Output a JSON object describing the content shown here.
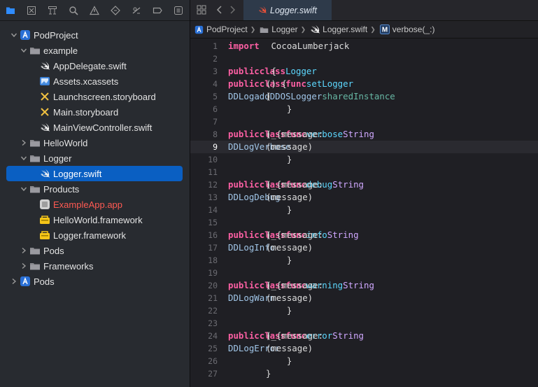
{
  "navigator": {
    "toolbar_icons": [
      "folder-icon",
      "source-control-icon",
      "symbol-icon",
      "search-icon",
      "issue-icon",
      "test-icon",
      "debug-icon",
      "breakpoint-icon",
      "report-icon"
    ],
    "tree": [
      {
        "label": "PodProject",
        "icon": "project-icon",
        "indent": 0,
        "disclosure": "open"
      },
      {
        "label": "example",
        "icon": "folder-icon",
        "indent": 1,
        "disclosure": "open"
      },
      {
        "label": "AppDelegate.swift",
        "icon": "swift-icon",
        "indent": 2,
        "disclosure": "none"
      },
      {
        "label": "Assets.xcassets",
        "icon": "assets-icon",
        "indent": 2,
        "disclosure": "none"
      },
      {
        "label": "Launchscreen.storyboard",
        "icon": "storyboard-icon",
        "indent": 2,
        "disclosure": "none"
      },
      {
        "label": "Main.storyboard",
        "icon": "storyboard-icon",
        "indent": 2,
        "disclosure": "none"
      },
      {
        "label": "MainViewController.swift",
        "icon": "swift-icon",
        "indent": 2,
        "disclosure": "none"
      },
      {
        "label": "HelloWorld",
        "icon": "folder-icon",
        "indent": 1,
        "disclosure": "closed"
      },
      {
        "label": "Logger",
        "icon": "folder-icon",
        "indent": 1,
        "disclosure": "open"
      },
      {
        "label": "Logger.swift",
        "icon": "swift-icon",
        "indent": 2,
        "disclosure": "none",
        "selected": true
      },
      {
        "label": "Products",
        "icon": "folder-icon",
        "indent": 1,
        "disclosure": "open"
      },
      {
        "label": "ExampleApp.app",
        "icon": "app-icon",
        "indent": 2,
        "disclosure": "none",
        "missing": true
      },
      {
        "label": "HelloWorld.framework",
        "icon": "framework-icon",
        "indent": 2,
        "disclosure": "none"
      },
      {
        "label": "Logger.framework",
        "icon": "framework-icon",
        "indent": 2,
        "disclosure": "none"
      },
      {
        "label": "Pods",
        "icon": "folder-icon",
        "indent": 1,
        "disclosure": "closed"
      },
      {
        "label": "Frameworks",
        "icon": "folder-icon",
        "indent": 1,
        "disclosure": "closed"
      },
      {
        "label": "Pods",
        "icon": "project-icon",
        "indent": 0,
        "disclosure": "closed"
      }
    ]
  },
  "editor": {
    "tab_label": "Logger.swift",
    "jump_bar": [
      {
        "label": "PodProject",
        "icon": "project-icon"
      },
      {
        "label": "Logger",
        "icon": "folder-icon"
      },
      {
        "label": "Logger.swift",
        "icon": "swift-icon"
      },
      {
        "label": "verbose(_:)",
        "icon": "method-icon"
      }
    ],
    "current_line": 9,
    "code": [
      [
        [
          "kw",
          "import"
        ],
        [
          "tx",
          " CocoaLumberjack"
        ]
      ],
      [],
      [
        [
          "kw",
          "public"
        ],
        [
          "tx",
          " "
        ],
        [
          "kw",
          "class"
        ],
        [
          "tx",
          " "
        ],
        [
          "fn",
          "Logger"
        ],
        [
          "tx",
          " {"
        ]
      ],
      [
        [
          "tx",
          "    "
        ],
        [
          "kw",
          "public"
        ],
        [
          "tx",
          " "
        ],
        [
          "kw",
          "class"
        ],
        [
          "tx",
          " "
        ],
        [
          "kw",
          "func"
        ],
        [
          "tx",
          " "
        ],
        [
          "fn",
          "setLogger"
        ],
        [
          "tx",
          "() {"
        ]
      ],
      [
        [
          "tx",
          "        "
        ],
        [
          "pj",
          "DDLog"
        ],
        [
          "tx",
          "."
        ],
        [
          "pj",
          "add"
        ],
        [
          "tx",
          "("
        ],
        [
          "pj",
          "DDOSLogger"
        ],
        [
          "tx",
          "."
        ],
        [
          "cx",
          "sharedInstance"
        ],
        [
          "tx",
          ")"
        ]
      ],
      [
        [
          "tx",
          "    }"
        ]
      ],
      [],
      [
        [
          "tx",
          "    "
        ],
        [
          "kw",
          "public"
        ],
        [
          "tx",
          " "
        ],
        [
          "kw",
          "class"
        ],
        [
          "tx",
          " "
        ],
        [
          "kw",
          "func"
        ],
        [
          "tx",
          " "
        ],
        [
          "fn",
          "verbose"
        ],
        [
          "tx",
          "(_ message: "
        ],
        [
          "ty",
          "String"
        ],
        [
          "tx",
          ") {"
        ]
      ],
      [
        [
          "tx",
          "        "
        ],
        [
          "pj",
          "DDLogVerbose"
        ],
        [
          "tx",
          "(message)"
        ]
      ],
      [
        [
          "tx",
          "    }"
        ]
      ],
      [],
      [
        [
          "tx",
          "    "
        ],
        [
          "kw",
          "public"
        ],
        [
          "tx",
          " "
        ],
        [
          "kw",
          "class"
        ],
        [
          "tx",
          " "
        ],
        [
          "kw",
          "func"
        ],
        [
          "tx",
          " "
        ],
        [
          "fn",
          "debug"
        ],
        [
          "tx",
          "(_ message: "
        ],
        [
          "ty",
          "String"
        ],
        [
          "tx",
          ") {"
        ]
      ],
      [
        [
          "tx",
          "        "
        ],
        [
          "pj",
          "DDLogDebug"
        ],
        [
          "tx",
          "(message)"
        ]
      ],
      [
        [
          "tx",
          "    }"
        ]
      ],
      [],
      [
        [
          "tx",
          "    "
        ],
        [
          "kw",
          "public"
        ],
        [
          "tx",
          " "
        ],
        [
          "kw",
          "class"
        ],
        [
          "tx",
          " "
        ],
        [
          "kw",
          "func"
        ],
        [
          "tx",
          " "
        ],
        [
          "fn",
          "info"
        ],
        [
          "tx",
          "(_ message: "
        ],
        [
          "ty",
          "String"
        ],
        [
          "tx",
          ") {"
        ]
      ],
      [
        [
          "tx",
          "        "
        ],
        [
          "pj",
          "DDLogInfo"
        ],
        [
          "tx",
          "(message)"
        ]
      ],
      [
        [
          "tx",
          "    }"
        ]
      ],
      [],
      [
        [
          "tx",
          "    "
        ],
        [
          "kw",
          "public"
        ],
        [
          "tx",
          " "
        ],
        [
          "kw",
          "class"
        ],
        [
          "tx",
          " "
        ],
        [
          "kw",
          "func"
        ],
        [
          "tx",
          " "
        ],
        [
          "fn",
          "warning"
        ],
        [
          "tx",
          "(_ message: "
        ],
        [
          "ty",
          "String"
        ],
        [
          "tx",
          ") {"
        ]
      ],
      [
        [
          "tx",
          "        "
        ],
        [
          "pj",
          "DDLogWarn"
        ],
        [
          "tx",
          "(message)"
        ]
      ],
      [
        [
          "tx",
          "    }"
        ]
      ],
      [],
      [
        [
          "tx",
          "    "
        ],
        [
          "kw",
          "public"
        ],
        [
          "tx",
          " "
        ],
        [
          "kw",
          "class"
        ],
        [
          "tx",
          " "
        ],
        [
          "kw",
          "func"
        ],
        [
          "tx",
          " "
        ],
        [
          "fn",
          "error"
        ],
        [
          "tx",
          "(_ message: "
        ],
        [
          "ty",
          "String"
        ],
        [
          "tx",
          ") {"
        ]
      ],
      [
        [
          "tx",
          "        "
        ],
        [
          "pj",
          "DDLogError"
        ],
        [
          "tx",
          "(message)"
        ]
      ],
      [
        [
          "tx",
          "    }"
        ]
      ],
      [
        [
          "tx",
          "}"
        ]
      ]
    ]
  },
  "colors": {
    "selection": "#0a5fc2",
    "keyword": "#fc5fa3",
    "type": "#d0a8ff",
    "declaration": "#5dd8ff",
    "missing_file": "#ff5a52",
    "accent_toolbar": "#2f8cff"
  }
}
